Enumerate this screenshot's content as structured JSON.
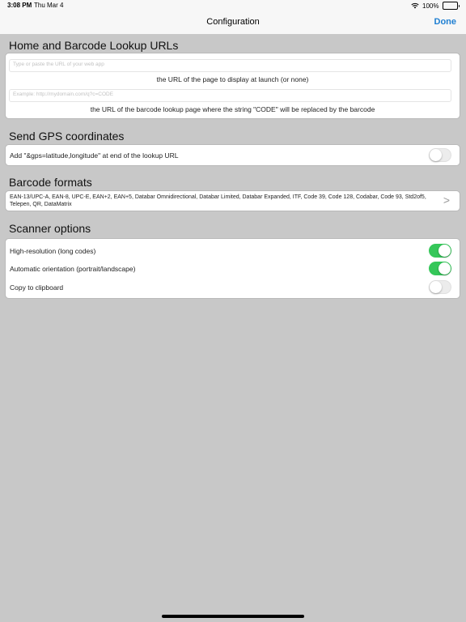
{
  "status_bar": {
    "time": "3:08 PM",
    "date": "Thu Mar 4",
    "battery": "100%",
    "icons": [
      "wifi-icon",
      "battery-icon"
    ]
  },
  "nav": {
    "title": "Configuration",
    "done_label": "Done"
  },
  "colors": {
    "accent": "#1f7fd2",
    "toggle_on": "#35c759",
    "background": "#c8c8c8"
  },
  "urls_section": {
    "title": "Home and Barcode Lookup URLs",
    "home_url": {
      "value": "",
      "placeholder": "Type or paste the URL of your web app",
      "help": "the URL of the page to display at launch (or none)"
    },
    "lookup_url": {
      "value": "",
      "placeholder": "Example: http://mydomain.com/q?c=CODE",
      "help": "the URL of the barcode lookup page where the string \"CODE\" will be replaced by the barcode"
    }
  },
  "gps_section": {
    "title": "Send GPS coordinates",
    "label": "Add \"&gps=latitude,longitude\" at end of the lookup URL",
    "enabled": false
  },
  "formats_section": {
    "title": "Barcode formats",
    "formats": "EAN-13/UPC-A, EAN-8, UPC-E, EAN+2, EAN+5, Databar Omnidirectional, Databar Limited, Databar Expanded, ITF, Code 39, Code 128, Codabar, Code 93, Std2of5, Telepen, QR, DataMatrix",
    "chevron": ">"
  },
  "scanner_section": {
    "title": "Scanner options",
    "options": [
      {
        "label": "High-resolution (long codes)",
        "enabled": true
      },
      {
        "label": "Automatic orientation (portrait/landscape)",
        "enabled": true
      },
      {
        "label": "Copy to clipboard",
        "enabled": false
      }
    ]
  }
}
